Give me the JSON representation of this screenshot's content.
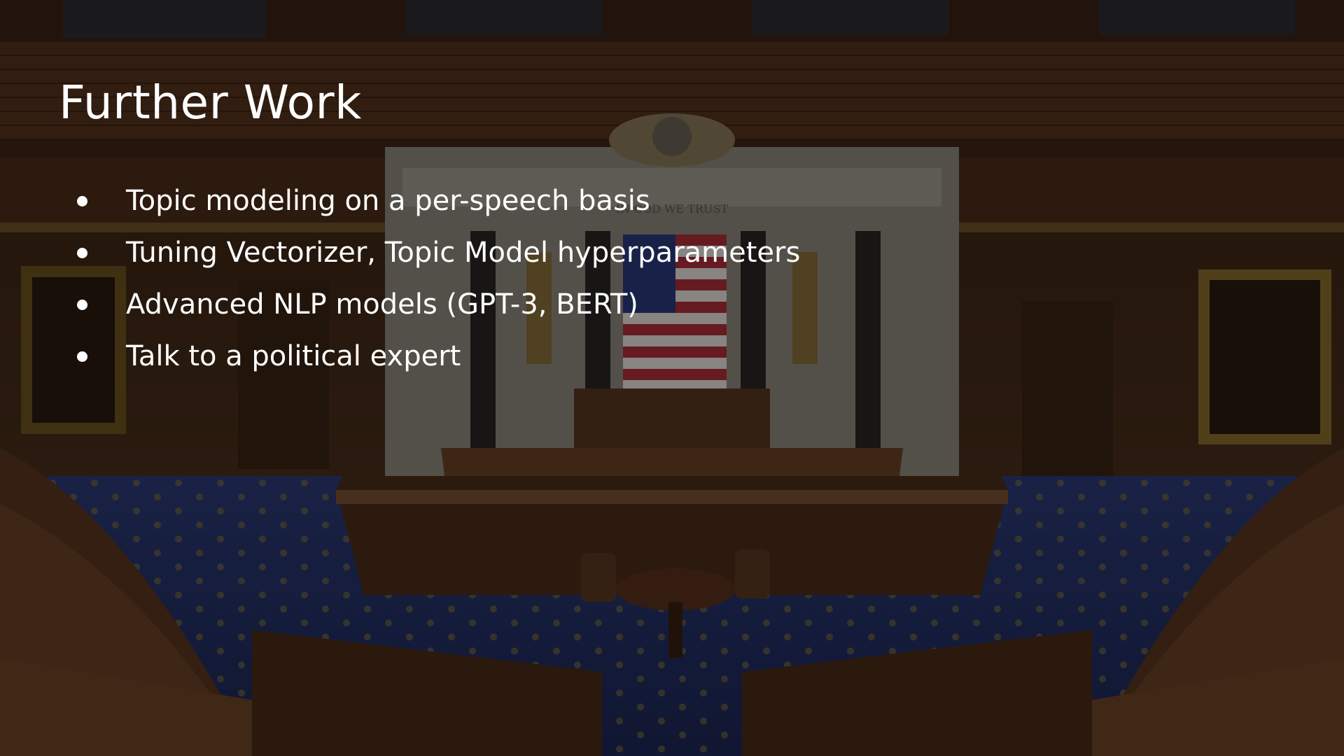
{
  "slide": {
    "title": "Further Work",
    "bullets": [
      "Topic modeling on a per-speech basis",
      "Tuning Vectorizer, Topic Model hyperparameters",
      "Advanced NLP models (GPT-3, BERT)",
      "Talk to a political expert"
    ]
  },
  "background": {
    "motto_text": "IN GOD WE TRUST"
  }
}
